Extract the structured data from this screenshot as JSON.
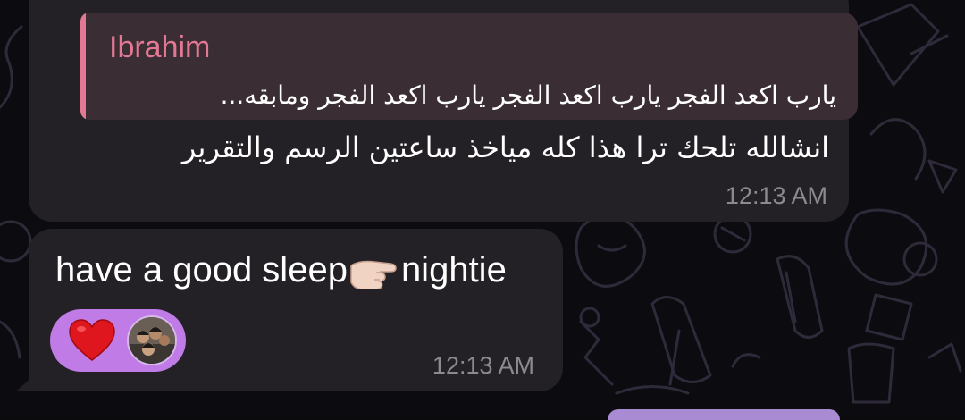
{
  "messages": [
    {
      "reply": {
        "author": "Ibrahim",
        "text": "يارب اكعد الفجر يارب اكعد الفجر يارب اكعد الفجر ومابقه..."
      },
      "text": "انشالله تلحك ترا هذا كله مياخذ ساعتين الرسم والتقرير",
      "time": "12:13 AM"
    },
    {
      "text_before": "have a good sleep",
      "emoji": "hand-pointing-icon",
      "text_after": "nightie",
      "reaction": {
        "emoji": "red-heart-icon",
        "reactor": "avatar"
      },
      "time": "12:13 AM"
    }
  ],
  "colors": {
    "background": "#0c0b0f",
    "bubble": "#232126",
    "reply_bg": "#3a2e34",
    "reply_accent": "#e27893",
    "reaction_pill": "#c07be6",
    "timestamp": "#8c8a90"
  }
}
